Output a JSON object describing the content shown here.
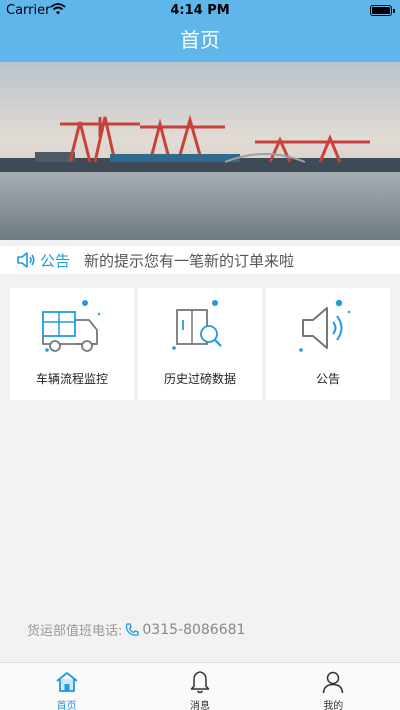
{
  "status_bar": {
    "carrier": "Carrier",
    "time": "4:14 PM"
  },
  "nav": {
    "title": "首页"
  },
  "notice": {
    "label": "公告",
    "text": "新的提示您有一笔新的订单来啦"
  },
  "cards": [
    {
      "label": "车辆流程监控",
      "icon": "truck-icon"
    },
    {
      "label": "历史过磅数据",
      "icon": "history-search-icon"
    },
    {
      "label": "公告",
      "icon": "announcement-speaker-icon"
    }
  ],
  "hotline": {
    "label": "货运部值班电话:",
    "number": "0315-8086681"
  },
  "tabs": [
    {
      "label": "首页",
      "icon": "home-icon",
      "active": true
    },
    {
      "label": "消息",
      "icon": "bell-icon",
      "active": false
    },
    {
      "label": "我的",
      "icon": "user-icon",
      "active": false
    }
  ],
  "colors": {
    "primary": "#5fb6ea",
    "accent": "#1e9be3",
    "background": "#f2f2f2"
  }
}
